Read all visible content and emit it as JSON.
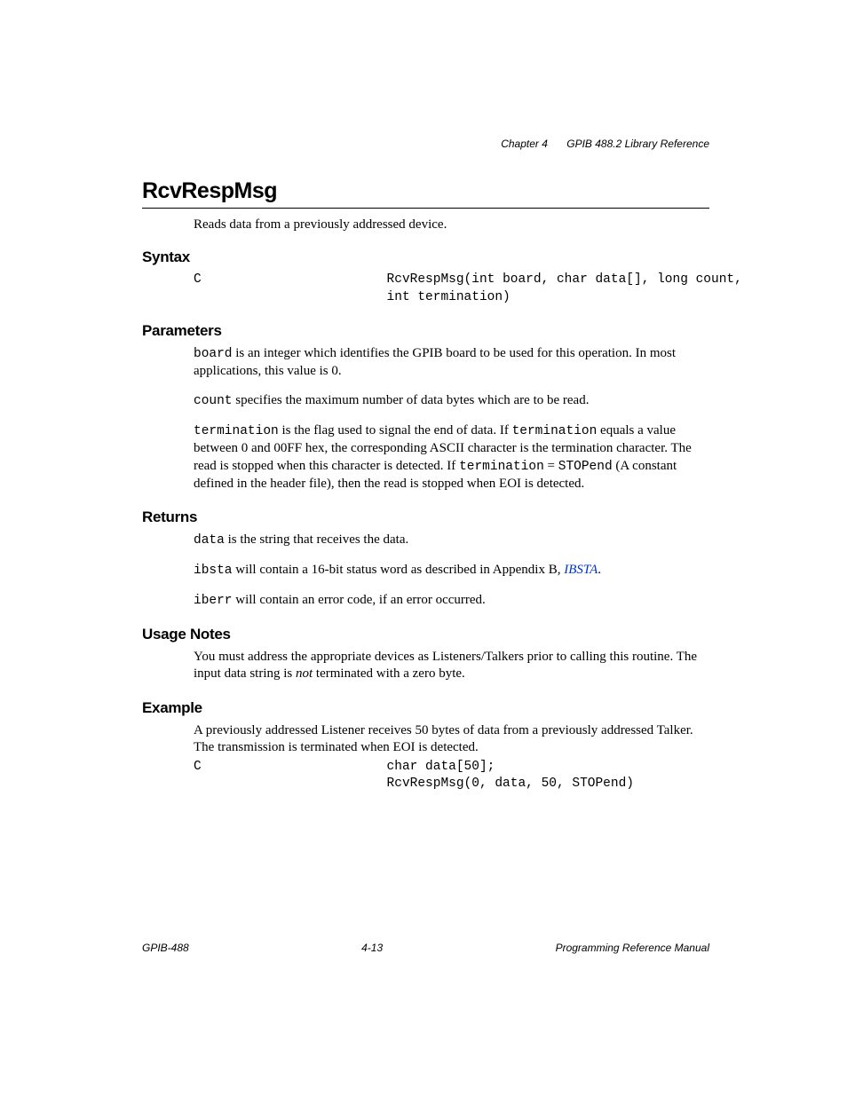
{
  "header": {
    "chapter": "Chapter 4",
    "section": "GPIB 488.2 Library Reference"
  },
  "title": "RcvRespMsg",
  "intro": "Reads data from a previously addressed device.",
  "syntax": {
    "heading": "Syntax",
    "lang": "C",
    "code": "RcvRespMsg(int board, char data[], long count,\nint termination)"
  },
  "parameters": {
    "heading": "Parameters",
    "p1_code": "board",
    "p1_rest": " is an integer which identifies the GPIB board to be used for this operation. In most applications, this value is 0.",
    "p2_code": "count",
    "p2_rest": " specifies the maximum number of data bytes which are to be read.",
    "p3_code1": "termination",
    "p3_mid1": " is the flag used to signal the end of data. If ",
    "p3_code2": "termination",
    "p3_mid2": " equals a value between 0 and 00FF hex, the corresponding ASCII character is the termination character. The read is stopped when this character is detected. If ",
    "p3_code3": "termination",
    "p3_mid3": " = ",
    "p3_code4": "STOPend",
    "p3_rest": " (A constant defined in the header file), then the read is stopped when EOI is detected."
  },
  "returns": {
    "heading": "Returns",
    "r1_code": "data",
    "r1_rest": " is the string that receives the data.",
    "r2_code": "ibsta",
    "r2_mid": " will contain a 16-bit status word as described in Appendix B, ",
    "r2_link": "IBSTA",
    "r2_end": ".",
    "r3_code": "iberr",
    "r3_rest": " will contain an error code, if an error occurred."
  },
  "usage": {
    "heading": "Usage Notes",
    "u1_start": "You must address the appropriate devices as Listeners/Talkers prior to calling this routine. The input data string is ",
    "u1_ital": "not",
    "u1_end": " terminated with a zero byte."
  },
  "example": {
    "heading": "Example",
    "desc": "A previously addressed Listener receives 50 bytes of data from a previously addressed Talker. The transmission is terminated when EOI is detected.",
    "lang": "C",
    "code": "char data[50];\nRcvRespMsg(0, data, 50, STOPend)"
  },
  "footer": {
    "left": "GPIB-488",
    "center": "4-13",
    "right": "Programming Reference Manual"
  }
}
